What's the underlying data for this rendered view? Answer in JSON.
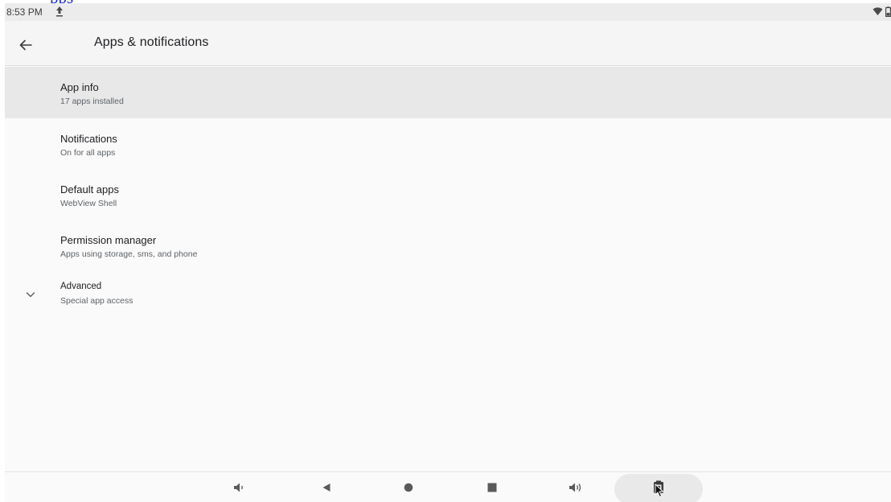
{
  "overlay_text": "pps",
  "status_bar": {
    "time": "8:53 PM"
  },
  "app_bar": {
    "title": "Apps & notifications"
  },
  "items": [
    {
      "title": "App info",
      "subtitle": "17 apps installed"
    },
    {
      "title": "Notifications",
      "subtitle": "On for all apps"
    },
    {
      "title": "Default apps",
      "subtitle": "WebView Shell"
    },
    {
      "title": "Permission manager",
      "subtitle": "Apps using storage, sms, and phone"
    },
    {
      "title": "Advanced",
      "subtitle": "Special app access"
    }
  ],
  "nav_buttons": [
    "volume-down-icon",
    "back-triangle-icon",
    "home-circle-icon",
    "recents-square-icon",
    "volume-up-icon",
    "screenshot-icon"
  ],
  "colors": {
    "selected_row": "#e8e8e8",
    "background": "#fafafa",
    "status_bar": "#ececec"
  }
}
